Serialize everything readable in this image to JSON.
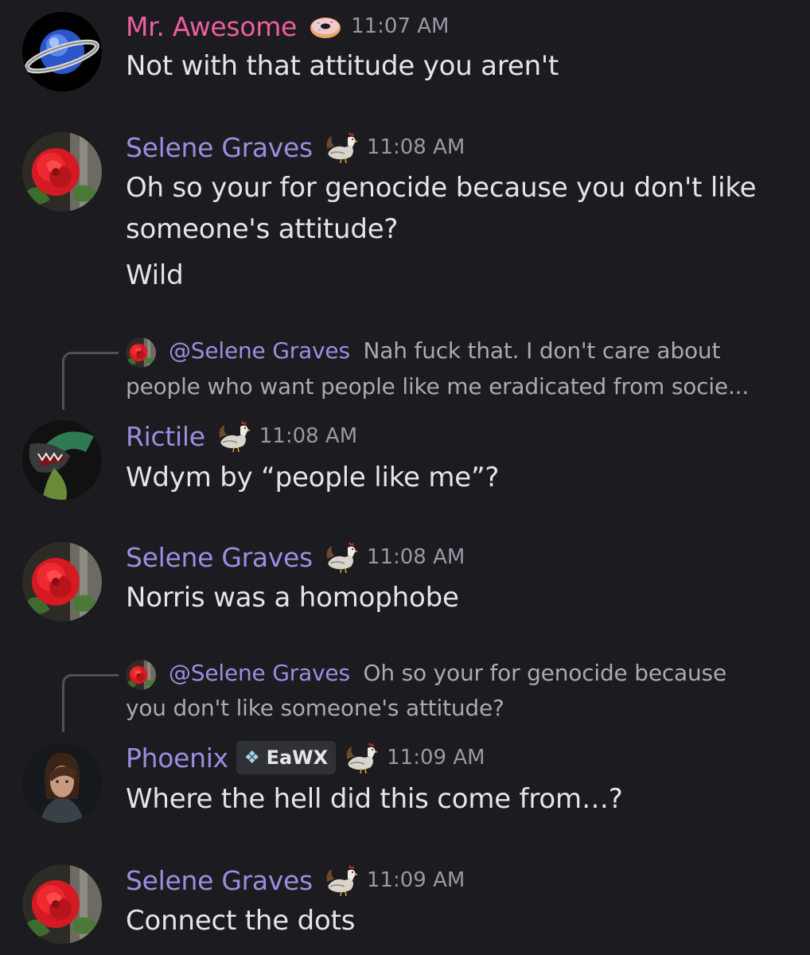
{
  "messages": [
    {
      "username": "Mr. Awesome",
      "badge_icon": "donut-icon",
      "timestamp": "11:07 AM",
      "lines": [
        "Not with that attitude you aren't"
      ]
    },
    {
      "username": "Selene Graves",
      "badge_icon": "rooster-icon",
      "timestamp": "11:08 AM",
      "lines": [
        "Oh so your for genocide because you don't like",
        "someone's attitude?",
        "Wild"
      ]
    },
    {
      "reply": {
        "mention": "@Selene Graves",
        "line1": "Nah fuck that. I don't care about",
        "line2": "people who want people like me eradicated from socie..."
      },
      "username": "Rictile",
      "badge_icon": "rooster-icon",
      "timestamp": "11:08 AM",
      "lines": [
        "Wdym by “people like me”?"
      ]
    },
    {
      "username": "Selene Graves",
      "badge_icon": "rooster-icon",
      "timestamp": "11:08 AM",
      "lines": [
        "Norris was a homophobe"
      ]
    },
    {
      "reply": {
        "mention": "@Selene Graves",
        "line1": "Oh so your for genocide because",
        "line2": "you don't like someone's attitude?"
      },
      "username": "Phoenix",
      "tag": {
        "icon": "❖",
        "label": "EaWX"
      },
      "badge_icon": "rooster-icon",
      "timestamp": "11:09 AM",
      "lines": [
        "Where the hell did this come from…?"
      ]
    },
    {
      "username": "Selene Graves",
      "badge_icon": "rooster-icon",
      "timestamp": "11:09 AM",
      "lines": [
        "Connect the dots"
      ]
    }
  ],
  "colors": {
    "background": "#1b1b20",
    "username_default": "#9b8ee0",
    "username_mr_awesome": "#ec5f9d",
    "message_text": "#e4e4ea",
    "timestamp": "#9899a3"
  }
}
